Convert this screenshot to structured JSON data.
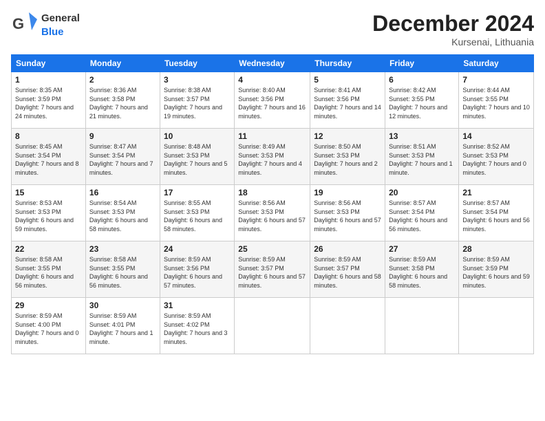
{
  "logo": {
    "general": "General",
    "blue": "Blue"
  },
  "header": {
    "month_year": "December 2024",
    "location": "Kursenai, Lithuania"
  },
  "days_of_week": [
    "Sunday",
    "Monday",
    "Tuesday",
    "Wednesday",
    "Thursday",
    "Friday",
    "Saturday"
  ],
  "weeks": [
    [
      {
        "day": "1",
        "sunrise": "Sunrise: 8:35 AM",
        "sunset": "Sunset: 3:59 PM",
        "daylight": "Daylight: 7 hours and 24 minutes."
      },
      {
        "day": "2",
        "sunrise": "Sunrise: 8:36 AM",
        "sunset": "Sunset: 3:58 PM",
        "daylight": "Daylight: 7 hours and 21 minutes."
      },
      {
        "day": "3",
        "sunrise": "Sunrise: 8:38 AM",
        "sunset": "Sunset: 3:57 PM",
        "daylight": "Daylight: 7 hours and 19 minutes."
      },
      {
        "day": "4",
        "sunrise": "Sunrise: 8:40 AM",
        "sunset": "Sunset: 3:56 PM",
        "daylight": "Daylight: 7 hours and 16 minutes."
      },
      {
        "day": "5",
        "sunrise": "Sunrise: 8:41 AM",
        "sunset": "Sunset: 3:56 PM",
        "daylight": "Daylight: 7 hours and 14 minutes."
      },
      {
        "day": "6",
        "sunrise": "Sunrise: 8:42 AM",
        "sunset": "Sunset: 3:55 PM",
        "daylight": "Daylight: 7 hours and 12 minutes."
      },
      {
        "day": "7",
        "sunrise": "Sunrise: 8:44 AM",
        "sunset": "Sunset: 3:55 PM",
        "daylight": "Daylight: 7 hours and 10 minutes."
      }
    ],
    [
      {
        "day": "8",
        "sunrise": "Sunrise: 8:45 AM",
        "sunset": "Sunset: 3:54 PM",
        "daylight": "Daylight: 7 hours and 8 minutes."
      },
      {
        "day": "9",
        "sunrise": "Sunrise: 8:47 AM",
        "sunset": "Sunset: 3:54 PM",
        "daylight": "Daylight: 7 hours and 7 minutes."
      },
      {
        "day": "10",
        "sunrise": "Sunrise: 8:48 AM",
        "sunset": "Sunset: 3:53 PM",
        "daylight": "Daylight: 7 hours and 5 minutes."
      },
      {
        "day": "11",
        "sunrise": "Sunrise: 8:49 AM",
        "sunset": "Sunset: 3:53 PM",
        "daylight": "Daylight: 7 hours and 4 minutes."
      },
      {
        "day": "12",
        "sunrise": "Sunrise: 8:50 AM",
        "sunset": "Sunset: 3:53 PM",
        "daylight": "Daylight: 7 hours and 2 minutes."
      },
      {
        "day": "13",
        "sunrise": "Sunrise: 8:51 AM",
        "sunset": "Sunset: 3:53 PM",
        "daylight": "Daylight: 7 hours and 1 minute."
      },
      {
        "day": "14",
        "sunrise": "Sunrise: 8:52 AM",
        "sunset": "Sunset: 3:53 PM",
        "daylight": "Daylight: 7 hours and 0 minutes."
      }
    ],
    [
      {
        "day": "15",
        "sunrise": "Sunrise: 8:53 AM",
        "sunset": "Sunset: 3:53 PM",
        "daylight": "Daylight: 6 hours and 59 minutes."
      },
      {
        "day": "16",
        "sunrise": "Sunrise: 8:54 AM",
        "sunset": "Sunset: 3:53 PM",
        "daylight": "Daylight: 6 hours and 58 minutes."
      },
      {
        "day": "17",
        "sunrise": "Sunrise: 8:55 AM",
        "sunset": "Sunset: 3:53 PM",
        "daylight": "Daylight: 6 hours and 58 minutes."
      },
      {
        "day": "18",
        "sunrise": "Sunrise: 8:56 AM",
        "sunset": "Sunset: 3:53 PM",
        "daylight": "Daylight: 6 hours and 57 minutes."
      },
      {
        "day": "19",
        "sunrise": "Sunrise: 8:56 AM",
        "sunset": "Sunset: 3:53 PM",
        "daylight": "Daylight: 6 hours and 57 minutes."
      },
      {
        "day": "20",
        "sunrise": "Sunrise: 8:57 AM",
        "sunset": "Sunset: 3:54 PM",
        "daylight": "Daylight: 6 hours and 56 minutes."
      },
      {
        "day": "21",
        "sunrise": "Sunrise: 8:57 AM",
        "sunset": "Sunset: 3:54 PM",
        "daylight": "Daylight: 6 hours and 56 minutes."
      }
    ],
    [
      {
        "day": "22",
        "sunrise": "Sunrise: 8:58 AM",
        "sunset": "Sunset: 3:55 PM",
        "daylight": "Daylight: 6 hours and 56 minutes."
      },
      {
        "day": "23",
        "sunrise": "Sunrise: 8:58 AM",
        "sunset": "Sunset: 3:55 PM",
        "daylight": "Daylight: 6 hours and 56 minutes."
      },
      {
        "day": "24",
        "sunrise": "Sunrise: 8:59 AM",
        "sunset": "Sunset: 3:56 PM",
        "daylight": "Daylight: 6 hours and 57 minutes."
      },
      {
        "day": "25",
        "sunrise": "Sunrise: 8:59 AM",
        "sunset": "Sunset: 3:57 PM",
        "daylight": "Daylight: 6 hours and 57 minutes."
      },
      {
        "day": "26",
        "sunrise": "Sunrise: 8:59 AM",
        "sunset": "Sunset: 3:57 PM",
        "daylight": "Daylight: 6 hours and 58 minutes."
      },
      {
        "day": "27",
        "sunrise": "Sunrise: 8:59 AM",
        "sunset": "Sunset: 3:58 PM",
        "daylight": "Daylight: 6 hours and 58 minutes."
      },
      {
        "day": "28",
        "sunrise": "Sunrise: 8:59 AM",
        "sunset": "Sunset: 3:59 PM",
        "daylight": "Daylight: 6 hours and 59 minutes."
      }
    ],
    [
      {
        "day": "29",
        "sunrise": "Sunrise: 8:59 AM",
        "sunset": "Sunset: 4:00 PM",
        "daylight": "Daylight: 7 hours and 0 minutes."
      },
      {
        "day": "30",
        "sunrise": "Sunrise: 8:59 AM",
        "sunset": "Sunset: 4:01 PM",
        "daylight": "Daylight: 7 hours and 1 minute."
      },
      {
        "day": "31",
        "sunrise": "Sunrise: 8:59 AM",
        "sunset": "Sunset: 4:02 PM",
        "daylight": "Daylight: 7 hours and 3 minutes."
      },
      null,
      null,
      null,
      null
    ]
  ]
}
